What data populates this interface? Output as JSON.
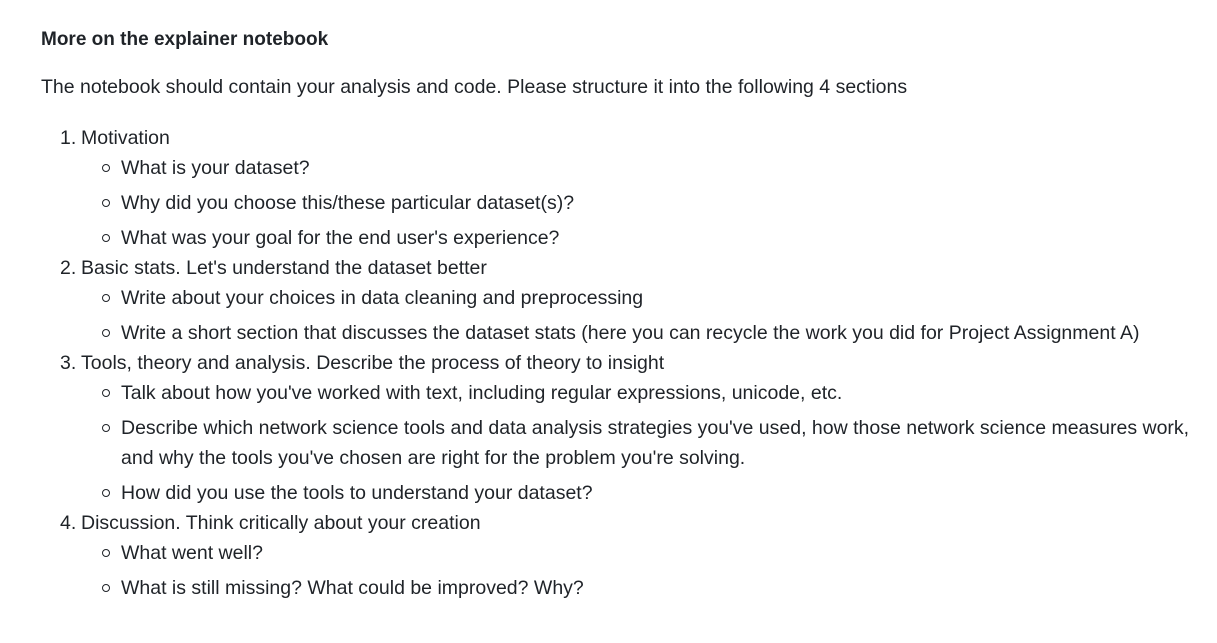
{
  "heading": "More on the explainer notebook",
  "intro": "The notebook should contain your analysis and code. Please structure it into the following 4 sections",
  "sections": [
    {
      "number": "1.",
      "title": "Motivation",
      "items": [
        "What is your dataset?",
        "Why did you choose this/these particular dataset(s)?",
        "What was your goal for the end user's experience?"
      ]
    },
    {
      "number": "2.",
      "title": "Basic stats. Let's understand the dataset better",
      "items": [
        "Write about your choices in data cleaning and preprocessing",
        "Write a short section that discusses the dataset stats (here you can recycle the work you did for Project Assignment A)"
      ]
    },
    {
      "number": "3.",
      "title": "Tools, theory and analysis. Describe the process of theory to insight",
      "items": [
        "Talk about how you've worked with text, including regular expressions, unicode, etc.",
        "Describe which network science tools and data analysis strategies you've used, how those network science measures work, and why the tools you've chosen are right for the problem you're solving.",
        "How did you use the tools to understand your dataset?"
      ]
    },
    {
      "number": "4.",
      "title": "Discussion. Think critically about your creation",
      "items": [
        "What went well?",
        "What is still missing? What could be improved? Why?"
      ]
    }
  ]
}
